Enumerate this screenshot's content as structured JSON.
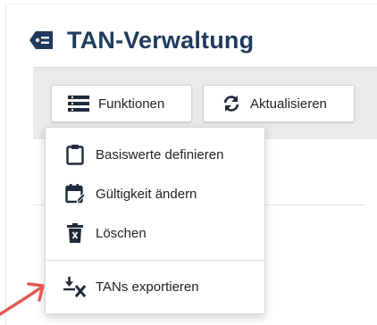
{
  "page": {
    "title": "TAN-Verwaltung",
    "title_icon": "tag-icon"
  },
  "toolbar": {
    "functions_label": "Funktionen",
    "functions_icon": "list-menu-icon",
    "refresh_label": "Aktualisieren",
    "refresh_icon": "refresh-icon"
  },
  "menu": {
    "items": [
      {
        "label": "Basiswerte definieren",
        "icon": "clipboard-icon"
      },
      {
        "label": "Gültigkeit ändern",
        "icon": "calendar-edit-icon"
      },
      {
        "label": "Löschen",
        "icon": "trash-icon"
      },
      {
        "label": "TANs exportieren",
        "icon": "download-x-icon"
      }
    ]
  },
  "colors": {
    "title": "#1f3a5c",
    "toolbar_bg": "#e9eaec",
    "annotation_arrow": "#e05a50"
  }
}
